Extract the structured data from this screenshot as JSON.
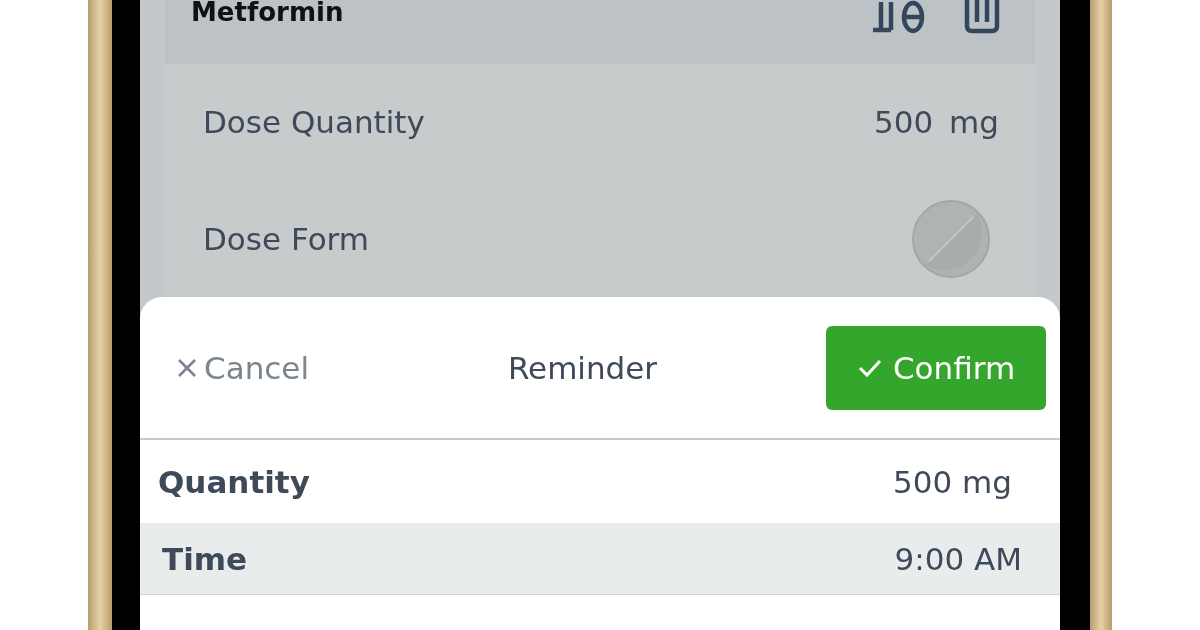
{
  "header": {
    "title": "Metformin"
  },
  "details": [
    {
      "label": "Dose Quantity",
      "kind": "amount",
      "value": "500",
      "unit": "mg"
    },
    {
      "label": "Dose Form",
      "kind": "pill"
    }
  ],
  "sheet": {
    "cancel": "Cancel",
    "title": "Reminder",
    "confirm": "Confirm"
  },
  "rows": [
    {
      "label": "Quantity",
      "value": "500 mg",
      "selected": false
    },
    {
      "label": "Time",
      "value": "9:00 AM",
      "selected": true
    }
  ]
}
